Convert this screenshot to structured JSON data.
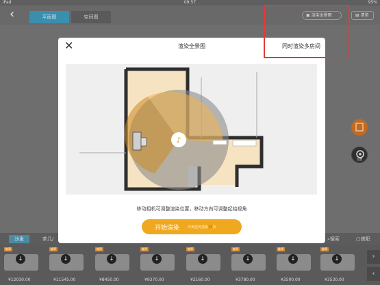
{
  "status": {
    "device": "iPad",
    "time": "09:57",
    "battery": "95%"
  },
  "nav": {
    "back_icon": "chevron-left-icon",
    "tab_plan": "平面图",
    "tab_space": "空间图",
    "render_panorama": "渲染全景图",
    "list": "清单"
  },
  "fab": {
    "settings_label": "设置"
  },
  "dialog": {
    "title": "渲染全景图",
    "multi_room": "同时渲染多房间",
    "hint": "移动相机可调整渲染位置，移动方向可调整起始视角",
    "start_label": "开始渲染",
    "quota_prefix": "今天还可渲染",
    "quota_count": "15",
    "quota_suffix": "次"
  },
  "bottom": {
    "tab_sofa": "沙发",
    "tab_tea": "茶几/",
    "search": "搜索",
    "match": "搭配"
  },
  "products": [
    {
      "tag": "推荐",
      "price": "¥12030.00"
    },
    {
      "tag": "推荐",
      "price": "¥11545.00"
    },
    {
      "tag": "推荐",
      "price": "¥8450.00"
    },
    {
      "tag": "推荐",
      "price": "¥9370.00"
    },
    {
      "tag": "推荐",
      "price": "¥2160.00"
    },
    {
      "tag": "推荐",
      "price": "¥3780.00"
    },
    {
      "tag": "推荐",
      "price": "¥2500.00"
    },
    {
      "tag": "推荐",
      "price": "¥3530.00"
    }
  ],
  "colors": {
    "accent": "#f0a81f",
    "highlight": "#e23a3a",
    "blue": "#3b8fae"
  }
}
